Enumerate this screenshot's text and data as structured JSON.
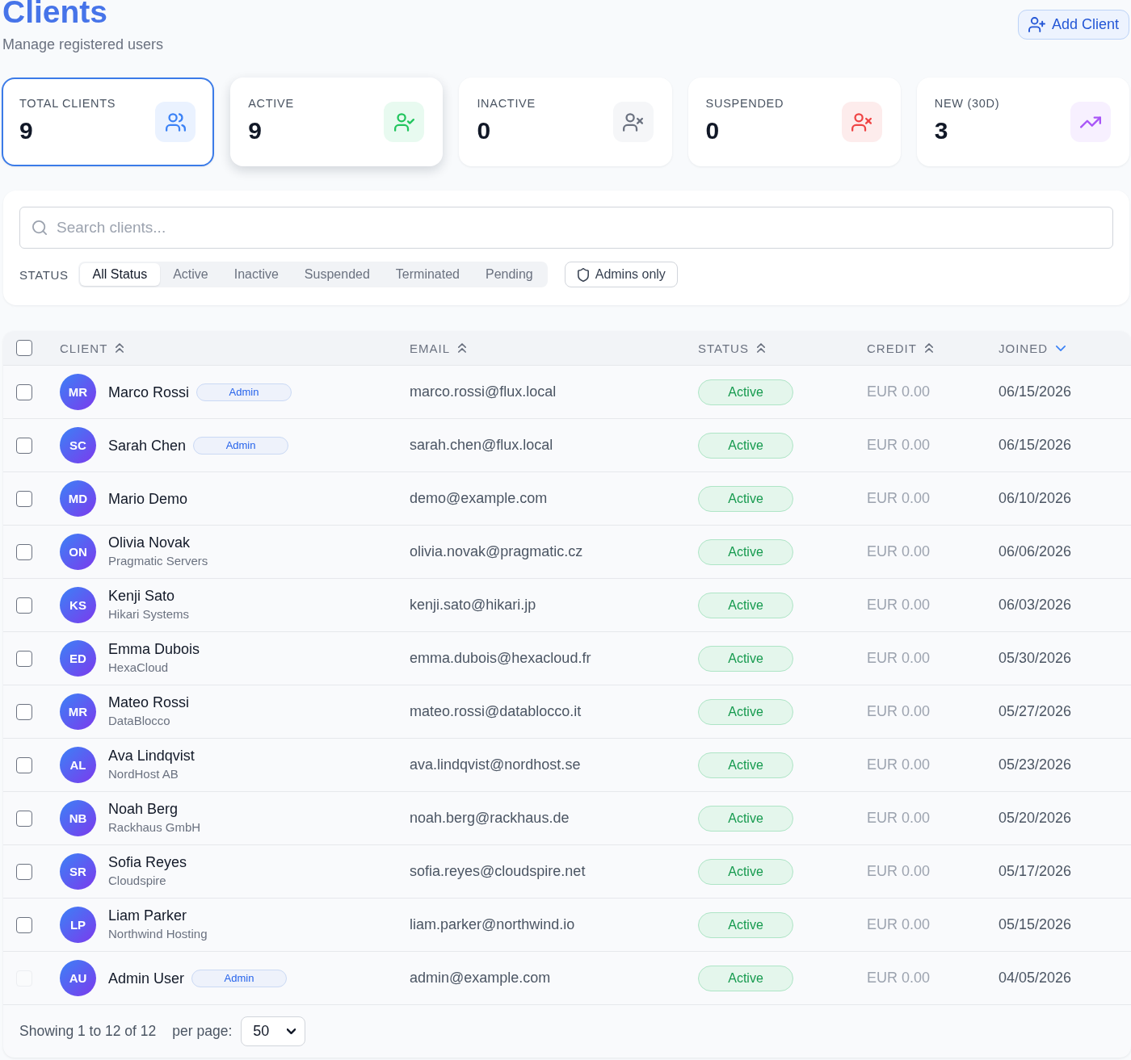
{
  "header": {
    "title": "Clients",
    "subtitle": "Manage registered users",
    "add_button": {
      "label": "Add Client"
    }
  },
  "stats": [
    {
      "kind": "total",
      "label": "TOTAL CLIENTS",
      "value": "9",
      "selected": true,
      "hovered": false
    },
    {
      "kind": "active",
      "label": "ACTIVE",
      "value": "9",
      "selected": false,
      "hovered": true
    },
    {
      "kind": "inactive",
      "label": "INACTIVE",
      "value": "0",
      "selected": false,
      "hovered": false
    },
    {
      "kind": "suspended",
      "label": "SUSPENDED",
      "value": "0",
      "selected": false,
      "hovered": false
    },
    {
      "kind": "new",
      "label": "NEW (30D)",
      "value": "3",
      "selected": false,
      "hovered": false
    }
  ],
  "filters": {
    "search": {
      "placeholder": "Search clients..."
    },
    "status_label": "STATUS",
    "status_options": [
      {
        "label": "All Status",
        "selected": true
      },
      {
        "label": "Active",
        "selected": false
      },
      {
        "label": "Inactive",
        "selected": false
      },
      {
        "label": "Suspended",
        "selected": false
      },
      {
        "label": "Terminated",
        "selected": false
      },
      {
        "label": "Pending",
        "selected": false
      }
    ],
    "admins_only": {
      "label": "Admins only",
      "on": false
    }
  },
  "table": {
    "select_all": {
      "checked": false
    },
    "columns": [
      {
        "label": "CLIENT",
        "sorted": false
      },
      {
        "label": "EMAIL",
        "sorted": false
      },
      {
        "label": "STATUS",
        "sorted": false
      },
      {
        "label": "CREDIT",
        "sorted": false
      },
      {
        "label": "JOINED",
        "sorted": true
      }
    ],
    "rows": [
      {
        "checked": false,
        "disabled": false,
        "initials": "MR",
        "name": "Marco Rossi",
        "badge": "Admin",
        "email": "marco.rossi@flux.local",
        "status": {
          "kind": "active",
          "label": "Active"
        },
        "credit": "EUR 0.00",
        "joined": "06/15/2026"
      },
      {
        "checked": false,
        "disabled": false,
        "initials": "SC",
        "name": "Sarah Chen",
        "badge": "Admin",
        "email": "sarah.chen@flux.local",
        "status": {
          "kind": "active",
          "label": "Active"
        },
        "credit": "EUR 0.00",
        "joined": "06/15/2026"
      },
      {
        "checked": false,
        "disabled": false,
        "initials": "MD",
        "name": "Mario Demo",
        "email": "demo@example.com",
        "status": {
          "kind": "active",
          "label": "Active"
        },
        "credit": "EUR 0.00",
        "joined": "06/10/2026"
      },
      {
        "checked": false,
        "disabled": false,
        "initials": "ON",
        "name": "Olivia Novak",
        "company": "Pragmatic Servers",
        "email": "olivia.novak@pragmatic.cz",
        "status": {
          "kind": "active",
          "label": "Active"
        },
        "credit": "EUR 0.00",
        "joined": "06/06/2026"
      },
      {
        "checked": false,
        "disabled": false,
        "initials": "KS",
        "name": "Kenji Sato",
        "company": "Hikari Systems",
        "email": "kenji.sato@hikari.jp",
        "status": {
          "kind": "active",
          "label": "Active"
        },
        "credit": "EUR 0.00",
        "joined": "06/03/2026"
      },
      {
        "checked": false,
        "disabled": false,
        "initials": "ED",
        "name": "Emma Dubois",
        "company": "HexaCloud",
        "email": "emma.dubois@hexacloud.fr",
        "status": {
          "kind": "active",
          "label": "Active"
        },
        "credit": "EUR 0.00",
        "joined": "05/30/2026"
      },
      {
        "checked": false,
        "disabled": false,
        "initials": "MR",
        "name": "Mateo Rossi",
        "company": "DataBlocco",
        "email": "mateo.rossi@datablocco.it",
        "status": {
          "kind": "active",
          "label": "Active"
        },
        "credit": "EUR 0.00",
        "joined": "05/27/2026"
      },
      {
        "checked": false,
        "disabled": false,
        "initials": "AL",
        "name": "Ava Lindqvist",
        "company": "NordHost AB",
        "email": "ava.lindqvist@nordhost.se",
        "status": {
          "kind": "active",
          "label": "Active"
        },
        "credit": "EUR 0.00",
        "joined": "05/23/2026"
      },
      {
        "checked": false,
        "disabled": false,
        "initials": "NB",
        "name": "Noah Berg",
        "company": "Rackhaus GmbH",
        "email": "noah.berg@rackhaus.de",
        "status": {
          "kind": "active",
          "label": "Active"
        },
        "credit": "EUR 0.00",
        "joined": "05/20/2026"
      },
      {
        "checked": false,
        "disabled": false,
        "initials": "SR",
        "name": "Sofia Reyes",
        "company": "Cloudspire",
        "email": "sofia.reyes@cloudspire.net",
        "status": {
          "kind": "active",
          "label": "Active"
        },
        "credit": "EUR 0.00",
        "joined": "05/17/2026"
      },
      {
        "checked": false,
        "disabled": false,
        "initials": "LP",
        "name": "Liam Parker",
        "company": "Northwind Hosting",
        "email": "liam.parker@northwind.io",
        "status": {
          "kind": "active",
          "label": "Active"
        },
        "credit": "EUR 0.00",
        "joined": "05/15/2026"
      },
      {
        "checked": false,
        "disabled": true,
        "initials": "AU",
        "name": "Admin User",
        "badge": "Admin",
        "email": "admin@example.com",
        "status": {
          "kind": "active",
          "label": "Active"
        },
        "credit": "EUR 0.00",
        "joined": "04/05/2026"
      }
    ]
  },
  "footer": {
    "summary": "Showing 1 to 12 of 12",
    "per_page_label": "per page:",
    "per_page": {
      "value": "50"
    }
  }
}
